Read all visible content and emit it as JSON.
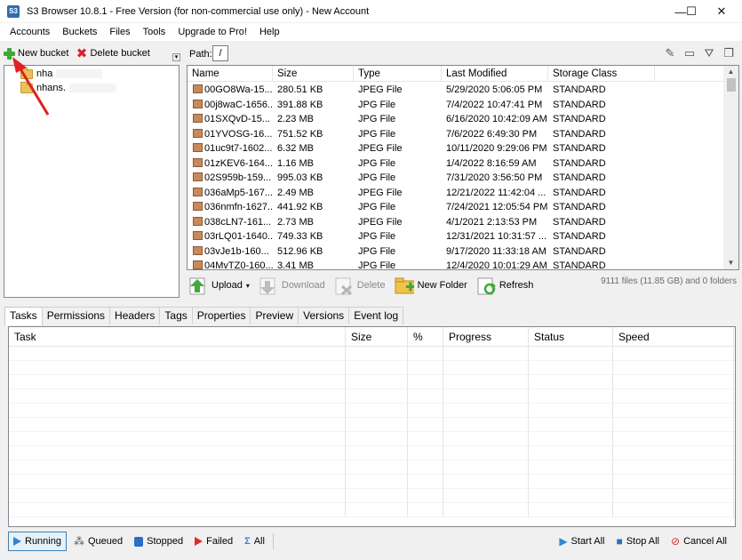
{
  "window": {
    "title": "S3 Browser 10.8.1 - Free Version (for non-commercial use only) - New Account",
    "icon_text": "S3",
    "minimize": "—",
    "maximize": "☐",
    "close": "✕"
  },
  "menu": [
    "Accounts",
    "Buckets",
    "Files",
    "Tools",
    "Upgrade to Pro!",
    "Help"
  ],
  "left_toolbar": {
    "new_bucket": "New bucket",
    "delete_bucket": "Delete bucket"
  },
  "buckets": [
    "nha",
    "nhans."
  ],
  "path": {
    "label": "Path:",
    "value": "/"
  },
  "file_list": {
    "columns": [
      "Name",
      "Size",
      "Type",
      "Last Modified",
      "Storage Class"
    ],
    "rows": [
      [
        "00GO8Wa-15...",
        "280.51 KB",
        "JPEG File",
        "5/29/2020 5:06:05 PM",
        "STANDARD"
      ],
      [
        "00j8waC-1656...",
        "391.88 KB",
        "JPG File",
        "7/4/2022 10:47:41 PM",
        "STANDARD"
      ],
      [
        "01SXQvD-15...",
        "2.23 MB",
        "JPG File",
        "6/16/2020 10:42:09 AM",
        "STANDARD"
      ],
      [
        "01YVOSG-16...",
        "751.52 KB",
        "JPG File",
        "7/6/2022 6:49:30 PM",
        "STANDARD"
      ],
      [
        "01uc9t7-1602...",
        "6.32 MB",
        "JPEG File",
        "10/11/2020 9:29:06 PM",
        "STANDARD"
      ],
      [
        "01zKEV6-164...",
        "1.16 MB",
        "JPG File",
        "1/4/2022 8:16:59 AM",
        "STANDARD"
      ],
      [
        "02S959b-159...",
        "995.03 KB",
        "JPG File",
        "7/31/2020 3:56:50 PM",
        "STANDARD"
      ],
      [
        "036aMp5-167...",
        "2.49 MB",
        "JPEG File",
        "12/21/2022 11:42:04 ...",
        "STANDARD"
      ],
      [
        "036nmfn-1627...",
        "441.92 KB",
        "JPG File",
        "7/24/2021 12:05:54 PM",
        "STANDARD"
      ],
      [
        "038cLN7-161...",
        "2.73 MB",
        "JPEG File",
        "4/1/2021 2:13:53 PM",
        "STANDARD"
      ],
      [
        "03rLQ01-1640...",
        "749.33 KB",
        "JPG File",
        "12/31/2021 10:31:57 ...",
        "STANDARD"
      ],
      [
        "03vJe1b-160...",
        "512.96 KB",
        "JPG File",
        "9/17/2020 11:33:18 AM",
        "STANDARD"
      ],
      [
        "04MvTZ0-160...",
        "3.41 MB",
        "JPG File",
        "12/4/2020 10:01:29 AM",
        "STANDARD"
      ]
    ]
  },
  "file_actions": {
    "upload": "Upload",
    "download": "Download",
    "delete": "Delete",
    "new_folder": "New Folder",
    "refresh": "Refresh"
  },
  "file_count": "9111 files (11.85 GB) and 0 folders",
  "tabs": [
    "Tasks",
    "Permissions",
    "Headers",
    "Tags",
    "Properties",
    "Preview",
    "Versions",
    "Event log"
  ],
  "task_table": {
    "columns": [
      "Task",
      "Size",
      "%",
      "Progress",
      "Status",
      "Speed"
    ]
  },
  "bottom_bar": {
    "running": "Running",
    "queued": "Queued",
    "stopped": "Stopped",
    "failed": "Failed",
    "all": "All",
    "start_all": "Start All",
    "stop_all": "Stop All",
    "cancel_all": "Cancel All"
  },
  "colors": {
    "arrow": "#e02020",
    "plus": "#3aaa35",
    "delete_x": "#d7232b",
    "folder": "#e8c15c"
  }
}
